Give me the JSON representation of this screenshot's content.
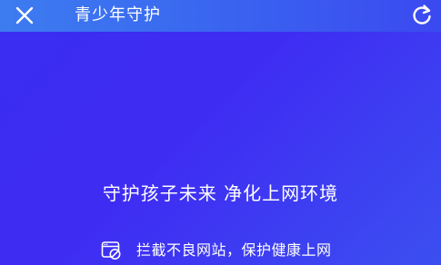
{
  "header": {
    "title": "青少年守护",
    "close_icon": "close-icon",
    "refresh_icon": "refresh-icon"
  },
  "main": {
    "slogan": "守护孩子未来 净化上网环境",
    "feature": {
      "icon": "blocked-web-icon",
      "text": "拦截不良网站，保护健康上网"
    }
  },
  "colors": {
    "background": "#3e2ef2",
    "header_start": "#3d7cf0",
    "header_end": "#3b49f0",
    "text": "#ffffff"
  }
}
